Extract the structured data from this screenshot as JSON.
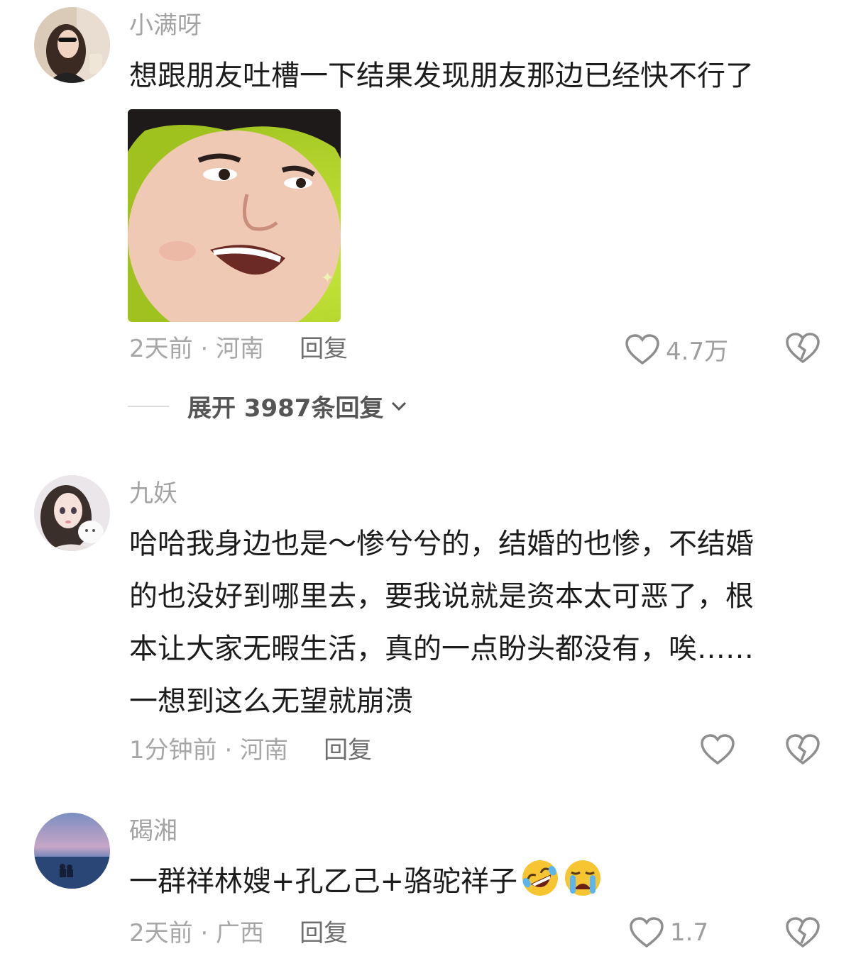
{
  "comments": [
    {
      "username": "小满呀",
      "text": "想跟朋友吐槽一下结果发现朋友那边已经快不行了",
      "time_location": "2天前 · 河南",
      "reply_label": "回复",
      "likes": "4.7万",
      "expand_label": "展开 3987条回复"
    },
    {
      "username": "九妖",
      "text_lines": [
        "哈哈我身边也是～惨兮兮的，结婚的也惨，不结婚",
        "的也没好到哪里去，要我说就是资本太可恶了，根",
        "本让大家无暇生活，真的一点盼头都没有，唉……",
        "一想到这么无望就崩溃"
      ],
      "time_location": "1分钟前 · 河南",
      "reply_label": "回复"
    },
    {
      "username": "碣湘",
      "text": "一群祥林嫂+孔乙己+骆驼祥子",
      "emojis": [
        "rofl-emoji",
        "crying-emoji"
      ],
      "time_location": "2天前 · 广西",
      "reply_label": "回复",
      "likes": "1.7"
    }
  ]
}
